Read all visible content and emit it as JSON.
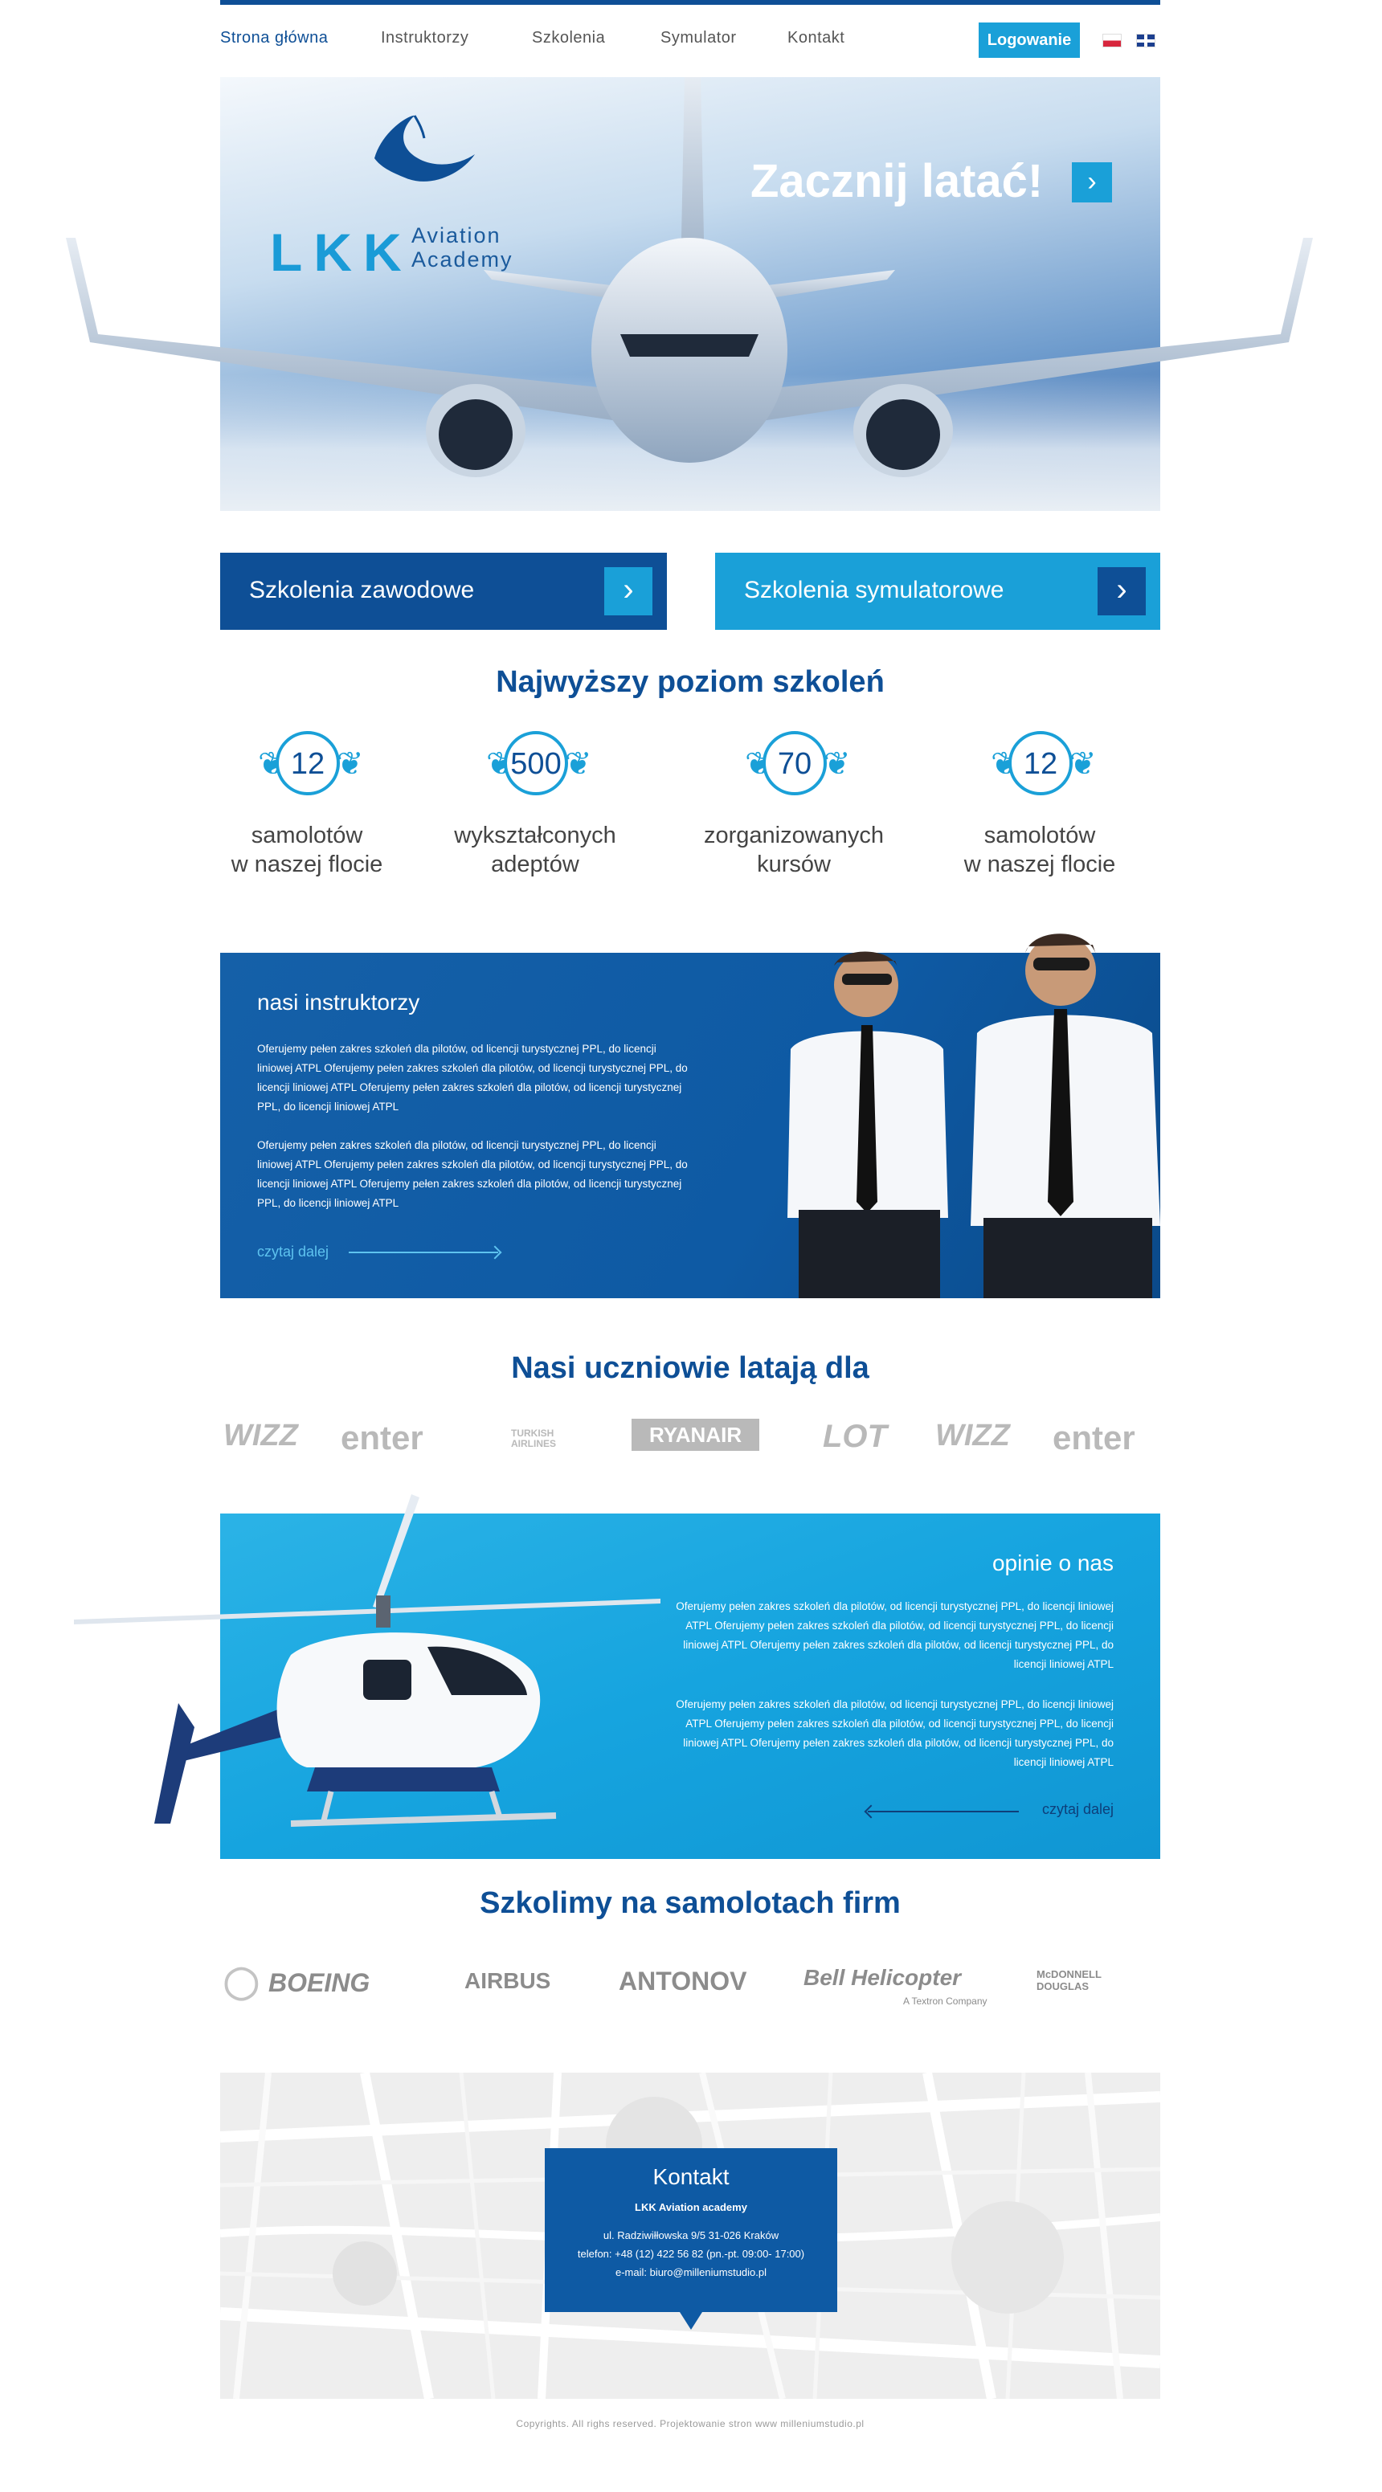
{
  "nav": {
    "items": [
      "Strona główna",
      "Instruktorzy",
      "Szkolenia",
      "Symulator",
      "Kontakt"
    ],
    "login": "Logowanie",
    "languages": [
      "pl",
      "en"
    ]
  },
  "hero": {
    "logo_mark": "LKK",
    "logo_sub_1": "Aviation",
    "logo_sub_2": "Academy",
    "cta": "Zacznij latać!",
    "cta_icon": "chevron-right-icon"
  },
  "trainings": {
    "professional": "Szkolenia zawodowe",
    "simulator": "Szkolenia symulatorowe"
  },
  "stats": {
    "title": "Najwyższy poziom szkoleń",
    "items": [
      {
        "num": "12",
        "line1": "samolotów",
        "line2": "w naszej flocie"
      },
      {
        "num": "500",
        "line1": "wykształconych",
        "line2": "adeptów"
      },
      {
        "num": "70",
        "line1": "zorganizowanych",
        "line2": "kursów"
      },
      {
        "num": "12",
        "line1": "samolotów",
        "line2": "w naszej flocie"
      }
    ]
  },
  "instructors": {
    "title": "nasi instruktorzy",
    "p1": "Oferujemy pełen zakres szkoleń dla pilotów, od licencji turystycznej PPL, do licencji liniowej ATPL Oferujemy pełen zakres szkoleń dla pilotów, od licencji turystycznej PPL, do licencji liniowej ATPL  Oferujemy pełen zakres szkoleń dla pilotów, od licencji turystycznej PPL, do licencji liniowej ATPL",
    "p2": "Oferujemy pełen zakres szkoleń dla pilotów, od licencji turystycznej PPL, do licencji liniowej ATPL Oferujemy pełen zakres szkoleń dla pilotów, od licencji turystycznej PPL, do licencji liniowej ATPL Oferujemy pełen zakres szkoleń dla pilotów, od licencji turystycznej PPL, do licencji liniowej ATPL",
    "more": "czytaj dalej"
  },
  "airlines": {
    "title": "Nasi uczniowie latają dla",
    "logos": [
      "WIZZ",
      "enter",
      "TURKISH AIRLINES",
      "RYANAIR",
      "LOT",
      "WIZZ",
      "enter"
    ]
  },
  "opinions": {
    "title": "opinie o nas",
    "p1": "Oferujemy pełen zakres szkoleń dla pilotów, od licencji turystycznej PPL, do licencji liniowej ATPL Oferujemy pełen zakres szkoleń dla pilotów, od licencji turystycznej PPL, do licencji liniowej ATPL  Oferujemy pełen zakres szkoleń dla pilotów, od licencji turystycznej PPL, do licencji liniowej ATPL",
    "p2": "Oferujemy pełen zakres szkoleń dla pilotów, od licencji turystycznej PPL, do licencji liniowej ATPL Oferujemy pełen zakres szkoleń dla pilotów, od licencji turystycznej PPL, do licencji liniowej ATPL Oferujemy pełen zakres szkoleń dla pilotów, od licencji turystycznej PPL, do licencji liniowej ATPL",
    "more": "czytaj dalej"
  },
  "manufacturers": {
    "title": "Szkolimy na samolotach firm",
    "logos": [
      "BOEING",
      "AIRBUS",
      "ANTONOV",
      "Bell Helicopter",
      "A Textron Company",
      "McDONNELL DOUGLAS"
    ]
  },
  "contact": {
    "title": "Kontakt",
    "name": "LKK Aviation academy",
    "address": "ul. Radziwiłłowska 9/5 31-026 Kraków",
    "phone": "telefon: +48 (12) 422 56 82 (pn.-pt. 09:00- 17:00)",
    "email": "e-mail: biuro@milleniumstudio.pl"
  },
  "footer": {
    "copyright": "Copyrights. All righs reserved. Projektowanie stron www milleniumstudio.pl"
  },
  "colors": {
    "primary": "#0e4f96",
    "accent": "#1aa0d8"
  }
}
